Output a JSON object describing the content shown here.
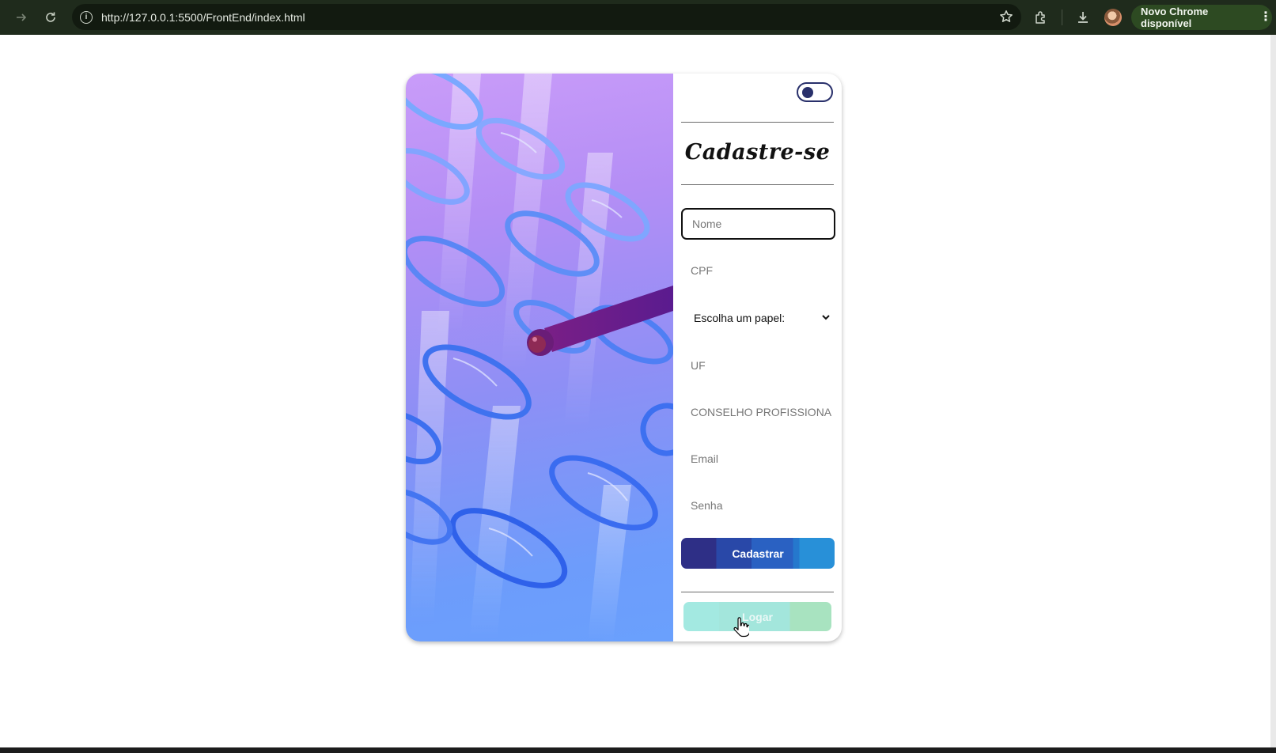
{
  "browser": {
    "url": "http://127.0.0.1:5500/FrontEnd/index.html",
    "update_label": "Novo Chrome disponível",
    "icons": [
      "forward-icon",
      "reload-icon",
      "site-info-icon",
      "bookmark-star-icon",
      "extensions-icon",
      "download-icon",
      "profile-avatar",
      "more-menu-icon"
    ]
  },
  "form": {
    "title": "Cadastre-se",
    "fields": {
      "nome": "Nome",
      "cpf": "CPF",
      "uf": "UF",
      "conselho": "CONSELHO PROFISSIONA",
      "email": "Email",
      "senha": "Senha"
    },
    "role_select": {
      "selected": "Escolha um papel:"
    },
    "submit_label": "Cadastrar",
    "login_label": "Logar",
    "theme_toggle": "off"
  },
  "colors": {
    "chrome_bg": "#1f2b1c",
    "accent_dark_blue": "#29306b",
    "cadastrar_blue": "#2a61c2",
    "logar_mint": "#a3e6dc",
    "art_purple": "#c99cf9",
    "art_blue": "#6aa0fd"
  }
}
